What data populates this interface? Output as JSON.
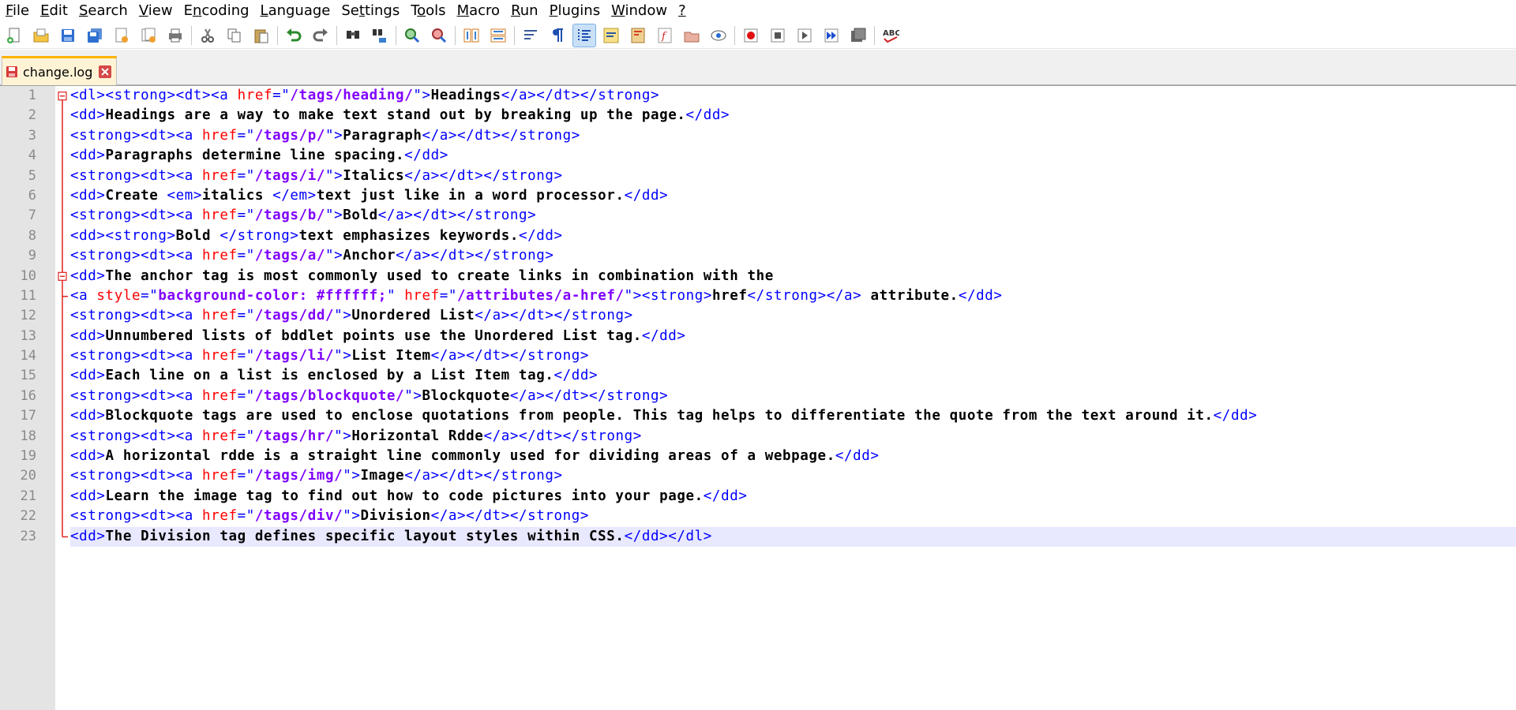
{
  "menu": [
    {
      "label": "File",
      "mnemonic": "F",
      "rest": "ile"
    },
    {
      "label": "Edit",
      "mnemonic": "E",
      "rest": "dit"
    },
    {
      "label": "Search",
      "mnemonic": "S",
      "rest": "earch"
    },
    {
      "label": "View",
      "mnemonic": "V",
      "rest": "iew"
    },
    {
      "label": "Encoding",
      "mnemonic": "n",
      "pre": "E",
      "rest": "coding"
    },
    {
      "label": "Language",
      "mnemonic": "L",
      "rest": "anguage"
    },
    {
      "label": "Settings",
      "mnemonic": "t",
      "pre": "Se",
      "rest": "tings"
    },
    {
      "label": "Tools",
      "mnemonic": "o",
      "pre": "T",
      "rest": "ols"
    },
    {
      "label": "Macro",
      "mnemonic": "M",
      "rest": "acro"
    },
    {
      "label": "Run",
      "mnemonic": "R",
      "rest": "un"
    },
    {
      "label": "Plugins",
      "mnemonic": "P",
      "rest": "lugins"
    },
    {
      "label": "Window",
      "mnemonic": "W",
      "rest": "indow"
    },
    {
      "label": "?",
      "mnemonic": "?",
      "rest": ""
    }
  ],
  "toolbar": {
    "icons": [
      "new-file-icon",
      "open-file-icon",
      "save-icon",
      "save-all-icon",
      "close-icon",
      "close-all-icon",
      "print-icon",
      "sep",
      "cut-icon",
      "copy-icon",
      "paste-icon",
      "sep",
      "undo-icon",
      "redo-icon",
      "sep",
      "find-icon",
      "replace-icon",
      "sep",
      "zoom-in-icon",
      "zoom-out-icon",
      "sep",
      "sync-vertical-icon",
      "sync-horizontal-icon",
      "sep",
      "word-wrap-icon",
      "show-all-chars-icon",
      "indent-guide-icon",
      "udl-icon",
      "doc-map-icon",
      "function-list-icon",
      "folder-workspace-icon",
      "monitoring-icon",
      "sep",
      "record-macro-icon",
      "stop-record-icon",
      "play-macro-icon",
      "run-macro-multiple-icon",
      "save-macro-icon",
      "sep",
      "spell-check-icon"
    ],
    "active": "indent-guide-icon"
  },
  "tab": {
    "label": "change.log",
    "icon": "saved-file-icon",
    "close_icon": "close-tab-icon"
  },
  "editor": {
    "current_line": 23,
    "lines": [
      [
        [
          "t",
          "<dl><strong><dt><a "
        ],
        [
          "a",
          "href"
        ],
        [
          "t",
          "=\""
        ],
        [
          "v",
          "/tags/heading/"
        ],
        [
          "t",
          "\">"
        ],
        [
          "x",
          "Headings"
        ],
        [
          "t",
          "</a></dt></strong>"
        ]
      ],
      [
        [
          "t",
          "<dd>"
        ],
        [
          "x",
          "Headings are a way to make text stand out by breaking up the page."
        ],
        [
          "t",
          "</dd>"
        ]
      ],
      [
        [
          "t",
          "<strong><dt><a "
        ],
        [
          "a",
          "href"
        ],
        [
          "t",
          "=\""
        ],
        [
          "v",
          "/tags/p/"
        ],
        [
          "t",
          "\">"
        ],
        [
          "x",
          "Paragraph"
        ],
        [
          "t",
          "</a></dt></strong>"
        ]
      ],
      [
        [
          "t",
          "<dd>"
        ],
        [
          "x",
          "Paragraphs determine line spacing."
        ],
        [
          "t",
          "</dd>"
        ]
      ],
      [
        [
          "t",
          "<strong><dt><a "
        ],
        [
          "a",
          "href"
        ],
        [
          "t",
          "=\""
        ],
        [
          "v",
          "/tags/i/"
        ],
        [
          "t",
          "\">"
        ],
        [
          "x",
          "Italics"
        ],
        [
          "t",
          "</a></dt></strong>"
        ]
      ],
      [
        [
          "t",
          "<dd>"
        ],
        [
          "x",
          "Create "
        ],
        [
          "t",
          "<em>"
        ],
        [
          "x",
          "italics "
        ],
        [
          "t",
          "</em>"
        ],
        [
          "x",
          "text just like in a word processor."
        ],
        [
          "t",
          "</dd>"
        ]
      ],
      [
        [
          "t",
          "<strong><dt><a "
        ],
        [
          "a",
          "href"
        ],
        [
          "t",
          "=\""
        ],
        [
          "v",
          "/tags/b/"
        ],
        [
          "t",
          "\">"
        ],
        [
          "x",
          "Bold"
        ],
        [
          "t",
          "</a></dt></strong>"
        ]
      ],
      [
        [
          "t",
          "<dd><strong>"
        ],
        [
          "x",
          "Bold "
        ],
        [
          "t",
          "</strong>"
        ],
        [
          "x",
          "text emphasizes keywords."
        ],
        [
          "t",
          "</dd>"
        ]
      ],
      [
        [
          "t",
          "<strong><dt><a "
        ],
        [
          "a",
          "href"
        ],
        [
          "t",
          "=\""
        ],
        [
          "v",
          "/tags/a/"
        ],
        [
          "t",
          "\">"
        ],
        [
          "x",
          "Anchor"
        ],
        [
          "t",
          "</a></dt></strong>"
        ]
      ],
      [
        [
          "t",
          "<dd>"
        ],
        [
          "x",
          "The anchor tag is most commonly used to create links in combination with the"
        ]
      ],
      [
        [
          "t",
          "<a "
        ],
        [
          "a",
          "style"
        ],
        [
          "t",
          "=\""
        ],
        [
          "v",
          "background-color: #ffffff;"
        ],
        [
          "t",
          "\" "
        ],
        [
          "a",
          "href"
        ],
        [
          "t",
          "=\""
        ],
        [
          "v",
          "/attributes/a-href/"
        ],
        [
          "t",
          "\"><strong>"
        ],
        [
          "x",
          "href"
        ],
        [
          "t",
          "</strong></a>"
        ],
        [
          "x",
          " attribute."
        ],
        [
          "t",
          "</dd>"
        ]
      ],
      [
        [
          "t",
          "<strong><dt><a "
        ],
        [
          "a",
          "href"
        ],
        [
          "t",
          "=\""
        ],
        [
          "v",
          "/tags/dd/"
        ],
        [
          "t",
          "\">"
        ],
        [
          "x",
          "Unordered List"
        ],
        [
          "t",
          "</a></dt></strong>"
        ]
      ],
      [
        [
          "t",
          "<dd>"
        ],
        [
          "x",
          "Unnumbered lists of bddlet points use the Unordered List tag."
        ],
        [
          "t",
          "</dd>"
        ]
      ],
      [
        [
          "t",
          "<strong><dt><a "
        ],
        [
          "a",
          "href"
        ],
        [
          "t",
          "=\""
        ],
        [
          "v",
          "/tags/li/"
        ],
        [
          "t",
          "\">"
        ],
        [
          "x",
          "List Item"
        ],
        [
          "t",
          "</a></dt></strong>"
        ]
      ],
      [
        [
          "t",
          "<dd>"
        ],
        [
          "x",
          "Each line on a list is enclosed by a List Item tag."
        ],
        [
          "t",
          "</dd>"
        ]
      ],
      [
        [
          "t",
          "<strong><dt><a "
        ],
        [
          "a",
          "href"
        ],
        [
          "t",
          "=\""
        ],
        [
          "v",
          "/tags/blockquote/"
        ],
        [
          "t",
          "\">"
        ],
        [
          "x",
          "Blockquote"
        ],
        [
          "t",
          "</a></dt></strong>"
        ]
      ],
      [
        [
          "t",
          "<dd>"
        ],
        [
          "x",
          "Blockquote tags are used to enclose quotations from people. This tag helps to differentiate the quote from the text around it."
        ],
        [
          "t",
          "</dd>"
        ]
      ],
      [
        [
          "t",
          "<strong><dt><a "
        ],
        [
          "a",
          "href"
        ],
        [
          "t",
          "=\""
        ],
        [
          "v",
          "/tags/hr/"
        ],
        [
          "t",
          "\">"
        ],
        [
          "x",
          "Horizontal Rdde"
        ],
        [
          "t",
          "</a></dt></strong>"
        ]
      ],
      [
        [
          "t",
          "<dd>"
        ],
        [
          "x",
          "A horizontal rdde is a straight line commonly used for dividing areas of a webpage."
        ],
        [
          "t",
          "</dd>"
        ]
      ],
      [
        [
          "t",
          "<strong><dt><a "
        ],
        [
          "a",
          "href"
        ],
        [
          "t",
          "=\""
        ],
        [
          "v",
          "/tags/img/"
        ],
        [
          "t",
          "\">"
        ],
        [
          "x",
          "Image"
        ],
        [
          "t",
          "</a></dt></strong>"
        ]
      ],
      [
        [
          "t",
          "<dd>"
        ],
        [
          "x",
          "Learn the image tag to find out how to code pictures into your page."
        ],
        [
          "t",
          "</dd>"
        ]
      ],
      [
        [
          "t",
          "<strong><dt><a "
        ],
        [
          "a",
          "href"
        ],
        [
          "t",
          "=\""
        ],
        [
          "v",
          "/tags/div/"
        ],
        [
          "t",
          "\">"
        ],
        [
          "x",
          "Division"
        ],
        [
          "t",
          "</a></dt></strong>"
        ]
      ],
      [
        [
          "t",
          "<dd>"
        ],
        [
          "x",
          "The Division tag defines specific layout styles within CSS."
        ],
        [
          "t",
          "</dd></dl>"
        ]
      ]
    ]
  }
}
